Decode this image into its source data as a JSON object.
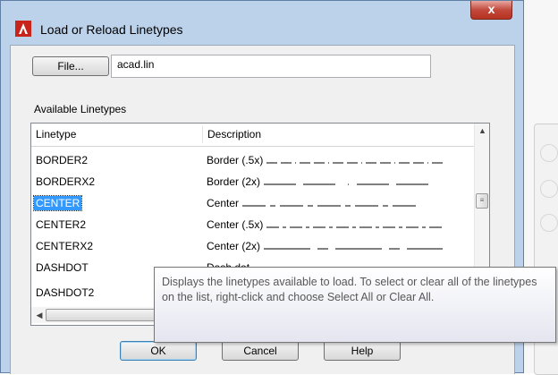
{
  "window": {
    "title": "Load or Reload Linetypes",
    "close_label": "x"
  },
  "file": {
    "button_label": "File...",
    "filename": "acad.lin"
  },
  "list": {
    "section_label": "Available Linetypes",
    "columns": [
      "Linetype",
      "Description"
    ],
    "rows": [
      {
        "linetype": "BORDER2",
        "description": "Border (.5x)",
        "selected": false
      },
      {
        "linetype": "BORDERX2",
        "description": "Border (2x)",
        "selected": false
      },
      {
        "linetype": "CENTER",
        "description": "Center",
        "selected": true
      },
      {
        "linetype": "CENTER2",
        "description": "Center (.5x)",
        "selected": false
      },
      {
        "linetype": "CENTERX2",
        "description": "Center (2x)",
        "selected": false
      },
      {
        "linetype": "DASHDOT",
        "description": "Dash dot",
        "selected": false
      },
      {
        "linetype": "DASHDOT2",
        "description": "",
        "selected": false
      }
    ]
  },
  "tooltip": {
    "text": "Displays the linetypes available to load. To select or clear all of the linetypes on the list, right-click and choose Select All or Clear All."
  },
  "buttons": {
    "ok": "OK",
    "cancel": "Cancel",
    "help": "Help"
  },
  "colors": {
    "selection": "#3399ff",
    "titlebar": "#bcd1ea",
    "close": "#c2493c"
  },
  "icons": {
    "app": "autocad-icon",
    "scroll_up": "scroll-up-arrow-icon",
    "scroll_left": "scroll-left-arrow-icon"
  }
}
